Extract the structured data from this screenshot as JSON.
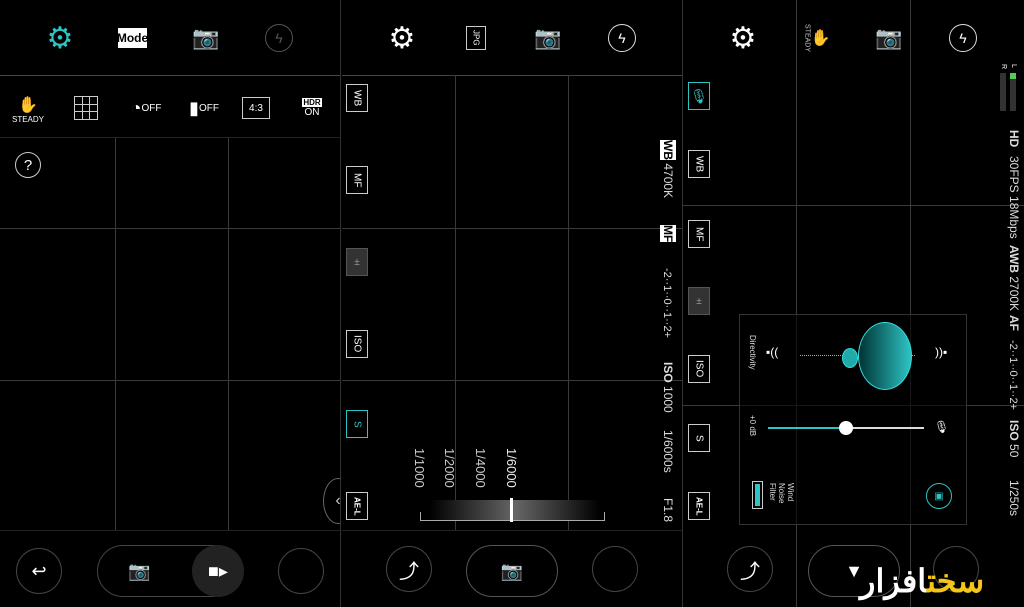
{
  "colors": {
    "accent": "#2ec4c4",
    "background": "#000000",
    "watermark_yellow": "#f5c518"
  },
  "panel1": {
    "topbar": [
      {
        "icon": "gear-icon",
        "active": true
      },
      {
        "label": "Mode"
      },
      {
        "icon": "switch-camera-icon"
      },
      {
        "icon": "flash-off-icon"
      }
    ],
    "settings": [
      {
        "icon": "steady-icon",
        "label": "STEADY"
      },
      {
        "icon": "grid-icon"
      },
      {
        "icon": "timer-icon",
        "label": "OFF"
      },
      {
        "icon": "voice-shutter-icon",
        "label": "OFF"
      },
      {
        "label": "4:3"
      },
      {
        "label": "HDR",
        "sub": "ON"
      }
    ],
    "help": "?"
  },
  "panel2": {
    "topbar": [
      {
        "icon": "gear-icon"
      },
      {
        "label": "JPG"
      },
      {
        "icon": "switch-camera-icon"
      },
      {
        "icon": "flash-off-icon"
      }
    ],
    "left_controls": [
      "WB",
      "MF",
      "EV",
      "ISO",
      "S",
      "AE-L"
    ],
    "status": {
      "wb": "WB",
      "wb_value": "4700K",
      "mf": "MF",
      "ev": "-2··1··0··1··2+",
      "iso": "ISO",
      "iso_value": "1000",
      "shutter": "1/6000s",
      "aperture": "F1.8"
    },
    "shutter_scale": [
      "1/1000",
      "1/2000",
      "1/4000",
      "1/6000"
    ]
  },
  "panel3": {
    "topbar": [
      {
        "icon": "gear-icon"
      },
      {
        "label": "STEADY"
      },
      {
        "icon": "switch-camera-icon"
      },
      {
        "icon": "flash-off-icon"
      }
    ],
    "left_controls": [
      "MIC",
      "WB",
      "MF",
      "EV",
      "ISO",
      "S",
      "AE-L"
    ],
    "audio_meter": {
      "left": "L",
      "right": "R",
      "level_left": 0.2,
      "level_right": 0
    },
    "status": {
      "res": "HD",
      "fps": "30FPS",
      "bitrate": "18Mbps",
      "awb": "AWB",
      "awb_value": "2700K",
      "af": "AF",
      "ev": "-2··1··0··1··2+",
      "iso": "ISO",
      "iso_value": "50",
      "shutter": "1/250s"
    },
    "audio_panel": {
      "directivity": "Directivity",
      "gain": "+0 dB",
      "gain_fraction": 0.5,
      "wind_filter": "Wind Noise Filter",
      "wind_filter_on": true
    }
  },
  "watermark": {
    "part1": "سخت",
    "part2": "افزار"
  }
}
